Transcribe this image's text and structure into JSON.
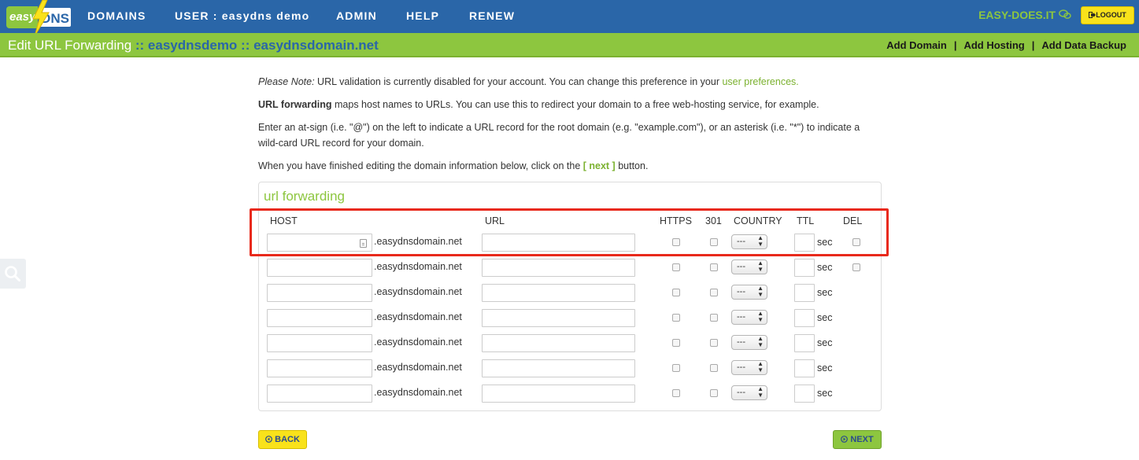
{
  "logo": {
    "easy": "easy",
    "dns": "DNS"
  },
  "nav": {
    "items": [
      "DOMAINS",
      "USER : easydns demo",
      "ADMIN",
      "HELP",
      "RENEW"
    ],
    "slogan": "EASY-DOES.IT",
    "logout": "LOGOUT"
  },
  "subbar": {
    "title": "Edit URL Forwarding",
    "domain_path": ":: easydnsdemo :: easydnsdomain.net",
    "links": [
      "Add Domain",
      "Add Hosting",
      "Add Data Backup"
    ]
  },
  "content": {
    "note_label": "Please Note:",
    "note_text": " URL validation is currently disabled for your account. You can change this preference in your ",
    "note_link": "user preferences.",
    "p2_bold": "URL forwarding",
    "p2_text": " maps host names to URLs. You can use this to redirect your domain to a free web-hosting service, for example.",
    "p3_text": "Enter an at-sign (i.e. \"@\") on the left to indicate a URL record for the root domain (e.g. \"example.com\"), or an asterisk (i.e. \"*\") to indicate a wild-card URL record for your domain.",
    "p4_before": "When you have finished editing the domain information below, click on the ",
    "p4_next": "[ next ]",
    "p4_after": " button."
  },
  "panel": {
    "title": "url forwarding",
    "columns": {
      "host": "HOST",
      "url": "URL",
      "https": "HTTPS",
      "r301": "301",
      "country": "COUNTRY",
      "ttl": "TTL",
      "del": "DEL"
    },
    "domain_suffix": ".easydnsdomain.net",
    "country_default": "---",
    "ttl_unit": "sec",
    "rows": 7,
    "rows_with_del": 2
  },
  "buttons": {
    "back": "BACK",
    "next": "NEXT"
  },
  "colors": {
    "nav_blue": "#2a66a8",
    "brand_green": "#8dc63f",
    "button_yellow": "#f9e21b",
    "highlight_red": "#e8291b"
  }
}
